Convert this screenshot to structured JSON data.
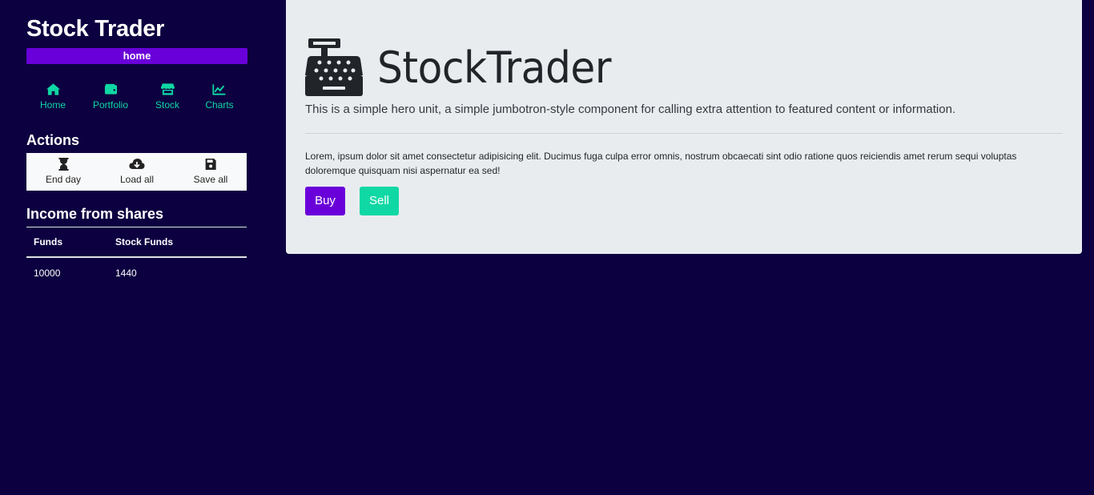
{
  "app": {
    "title": "Stock Trader",
    "route": "home"
  },
  "nav": [
    {
      "label": "Home",
      "icon": "home-icon"
    },
    {
      "label": "Portfolio",
      "icon": "wallet-icon"
    },
    {
      "label": "Stock",
      "icon": "store-icon"
    },
    {
      "label": "Charts",
      "icon": "chart-line-icon"
    }
  ],
  "actions": {
    "title": "Actions",
    "buttons": [
      {
        "label": "End day",
        "icon": "hourglass-icon"
      },
      {
        "label": "Load all",
        "icon": "cloud-download-icon"
      },
      {
        "label": "Save all",
        "icon": "save-icon"
      }
    ]
  },
  "income": {
    "title": "Income from shares",
    "columns": [
      "Funds",
      "Stock Funds"
    ],
    "rows": [
      [
        "10000",
        "1440"
      ]
    ]
  },
  "hero": {
    "icon": "cash-register-icon",
    "title": "StockTrader",
    "lead": "This is a simple hero unit, a simple jumbotron-style component for calling extra attention to featured content or information.",
    "text": "Lorem, ipsum dolor sit amet consectetur adipisicing elit. Ducimus fuga culpa error omnis, nostrum obcaecati sint odio ratione quos reiciendis amet rerum sequi voluptas doloremque quisquam nisi aspernatur ea sed!",
    "buy_label": "Buy",
    "sell_label": "Sell"
  },
  "colors": {
    "background": "#0c0040",
    "accent_purple": "#6a00d9",
    "accent_green": "#0fd8a4",
    "hero_bg": "#e9ecef"
  }
}
